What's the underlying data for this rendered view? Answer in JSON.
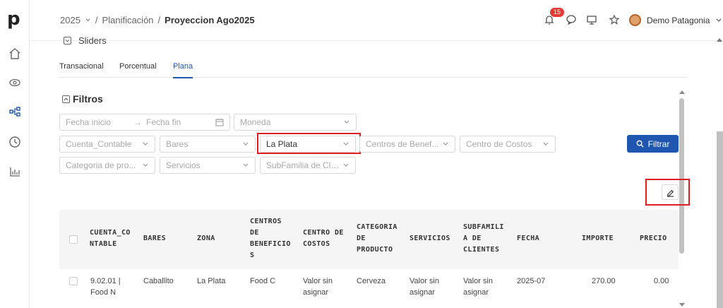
{
  "app": {
    "logo": "p"
  },
  "sidebar": {
    "items": [
      "home-icon",
      "eye-icon",
      "hierarchy-icon",
      "clock-icon",
      "bar-chart-icon"
    ]
  },
  "breadcrumb": {
    "year": "2025",
    "section": "Planificación",
    "current": "Proyeccion Ago2025"
  },
  "topbar": {
    "notifications_count": "15",
    "user_name": "Demo Patagonia"
  },
  "sliders": {
    "label": "Sliders"
  },
  "tabs": [
    {
      "label": "Transacional",
      "active": false
    },
    {
      "label": "Porcentual",
      "active": false
    },
    {
      "label": "Plana",
      "active": true
    }
  ],
  "filters": {
    "title": "Filtros",
    "date_start_placeholder": "Fecha inicio",
    "date_end_placeholder": "Fecha fin",
    "moneda": "Moneda",
    "cuenta_contable": "Cuenta_Contable",
    "bares": "Bares",
    "zona_value": "La Plata",
    "centros_beneficio": "Centros de Benef...",
    "centro_costos": "Centro de Costos",
    "categoria_producto": "Categoria de pro...",
    "servicios": "Servicios",
    "subfamilia": "SubFamilia de Cli...",
    "filter_button": "Filtrar"
  },
  "table": {
    "columns": [
      "CUENTA_CO\nNTABLE",
      "BARES",
      "ZONA",
      "CENTROS\nDE\nBENEFICIO\nS",
      "CENTRO DE\nCOSTOS",
      "CATEGORIA\nDE\nPRODUCTO",
      "SERVICIOS",
      "SUBFAMILI\nA DE\nCLIENTES",
      "FECHA",
      "IMPORTE",
      "PRECIO"
    ],
    "rows": [
      [
        "9.02.01 |\nFood N",
        "Caballito",
        "La Plata",
        "Food C",
        "Valor sin\nasignar",
        "Cerveza",
        "Valor sin\nasignar",
        "Valor sin\nasignar",
        "2025-07",
        "270.00",
        "0.00"
      ]
    ]
  },
  "colors": {
    "accent": "#1e56b0",
    "highlight": "#e02020",
    "badge": "#e53935"
  }
}
